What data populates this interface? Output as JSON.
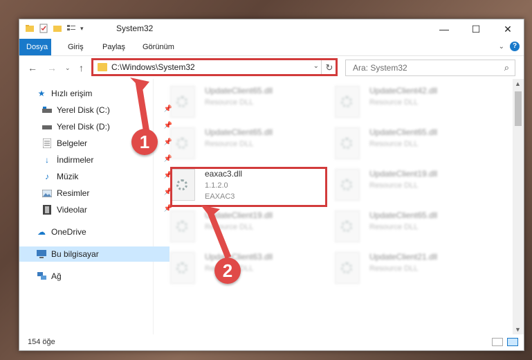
{
  "window": {
    "title": "System32"
  },
  "ribbon": {
    "tabs": [
      "Dosya",
      "Giriş",
      "Paylaş",
      "Görünüm"
    ]
  },
  "address": {
    "path": "C:\\Windows\\System32"
  },
  "search": {
    "placeholder": "Ara: System32"
  },
  "sidebar": {
    "items": [
      {
        "label": "Hızlı erişim",
        "icon": "star-icon"
      },
      {
        "label": "Yerel Disk (C:)",
        "icon": "drive-icon",
        "pinned": true
      },
      {
        "label": "Yerel Disk (D:)",
        "icon": "drive-icon",
        "pinned": true
      },
      {
        "label": "Belgeler",
        "icon": "document-icon",
        "pinned": true
      },
      {
        "label": "İndirmeler",
        "icon": "download-icon",
        "pinned": true
      },
      {
        "label": "Müzik",
        "icon": "music-icon",
        "pinned": true
      },
      {
        "label": "Resimler",
        "icon": "pictures-icon",
        "pinned": true
      },
      {
        "label": "Videolar",
        "icon": "video-icon",
        "pinned": true
      },
      {
        "label": "OneDrive",
        "icon": "cloud-icon"
      },
      {
        "label": "Bu bilgisayar",
        "icon": "computer-icon",
        "selected": true
      },
      {
        "label": "Ağ",
        "icon": "network-icon"
      }
    ]
  },
  "files": [
    {
      "name": "UpdateClient65.dll",
      "desc": "Resource DLL"
    },
    {
      "name": "UpdateClient42.dll",
      "desc": "Resource DLL"
    },
    {
      "name": "UpdateClient65.dll",
      "desc": "Resource DLL"
    },
    {
      "name": "UpdateClient65.dll",
      "desc": "Resource DLL"
    },
    {
      "name": "eaxac3.dll",
      "desc": "1.1.2.0",
      "desc2": "EAXAC3",
      "highlight": true
    },
    {
      "name": "UpdateClient19.dll",
      "desc": "Resource DLL"
    },
    {
      "name": "UpdateClient19.dll",
      "desc": "Resource DLL"
    },
    {
      "name": "UpdateClient65.dll",
      "desc": "Resource DLL"
    },
    {
      "name": "UpdateClient63.dll",
      "desc": "Resource DLL"
    },
    {
      "name": "UpdateClient21.dll",
      "desc": "Resource DLL"
    }
  ],
  "status": {
    "count": "154 öğe"
  },
  "annotations": {
    "step1": "1",
    "step2": "2"
  },
  "colors": {
    "accent": "#1979ca",
    "highlight": "#d23b3b",
    "selection": "#cce8ff",
    "folder": "#f5c84c"
  }
}
